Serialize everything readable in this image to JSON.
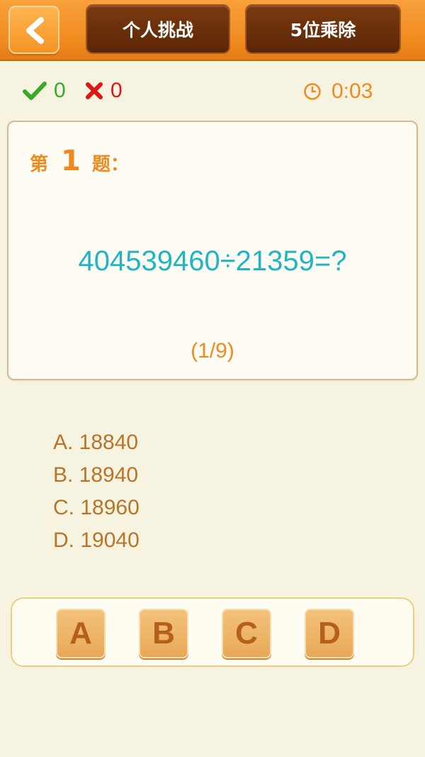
{
  "header": {
    "back_icon": "chevron-left-icon",
    "tabs": [
      {
        "label": "个人挑战"
      },
      {
        "label": "5位乘除"
      }
    ]
  },
  "stats": {
    "correct_icon": "checkmark-icon",
    "correct_count": "0",
    "wrong_icon": "cross-icon",
    "wrong_count": "0",
    "timer_icon": "clock-icon",
    "timer": "0:03"
  },
  "question": {
    "prefix": "第",
    "number": "1",
    "suffix": "题：",
    "expression": "404539460÷21359=?",
    "progress": "(1/9)"
  },
  "options": [
    {
      "text": "A. 18840"
    },
    {
      "text": "B. 18940"
    },
    {
      "text": "C. 18960"
    },
    {
      "text": "D. 19040"
    }
  ],
  "answer_buttons": [
    {
      "label": "A"
    },
    {
      "label": "B"
    },
    {
      "label": "C"
    },
    {
      "label": "D"
    }
  ],
  "colors": {
    "header": "#f08a1f",
    "tab": "#6b2f0b",
    "correct": "#3aa92b",
    "wrong": "#e01616",
    "expression": "#1fb5c3",
    "accent": "#f08a1f",
    "option_text": "#b8752a",
    "background": "#f7f3e1"
  }
}
